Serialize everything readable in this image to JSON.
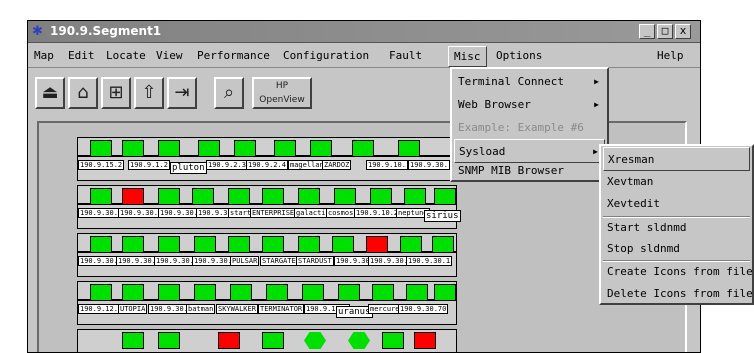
{
  "window": {
    "title": "190.9.Segment1",
    "minimize": "_",
    "maximize": "□",
    "close": "x"
  },
  "menubar": {
    "items": [
      "Map",
      "Edit",
      "Locate",
      "View",
      "Performance",
      "Configuration",
      "Fault",
      "Misc",
      "Options",
      "Help"
    ]
  },
  "toolbar": {
    "hp_label": "HP OpenView"
  },
  "misc_menu": {
    "items": [
      "Terminal Connect",
      "Web Browser",
      "Example: Example #6",
      "Sysload",
      "SNMP MIB Browser"
    ]
  },
  "sysload_menu": {
    "items": [
      "Xresman",
      "Xevtman",
      "Xevtedit",
      "Start sldnmd",
      "Stop sldnmd",
      "Create Icons from file",
      "Delete Icons from file"
    ]
  },
  "rows": [
    {
      "labels": [
        "190.9.15.2",
        "190.9.1.2",
        "pluton",
        "190.9.2.3",
        "190.9.2.4",
        "magellan",
        "ZARDOZ",
        "190.9.10.",
        "190.9.30."
      ]
    },
    {
      "labels": [
        "190.9.30.44",
        "190.9.30.24",
        "190.9.30.21",
        "190.9.30.6",
        "startrek",
        "ENTERPRISE",
        "galactica",
        "cosmos",
        "190.9.10.2",
        "neptune",
        "sirius",
        "saturne",
        "ti"
      ]
    },
    {
      "labels": [
        "190.9.30.",
        "190.9.30.6",
        "190.9.30.6",
        "190.9.30.69",
        "PULSAR",
        "STARGATE",
        "STARDUST",
        "190.9.30.",
        "190.9.30.1",
        "190.9.30.1",
        "190.9.30.3",
        "190.9.30.6",
        "190.9."
      ]
    },
    {
      "labels": [
        "190.9.12.13",
        "UTOPIA",
        "190.9.30.3",
        "batman",
        "SKYWALKER",
        "TERMINATOR",
        "190.9.10.1",
        "uranus",
        "mercure",
        "190.9.30.70",
        "190.9.30.27",
        "190.9.30.17",
        "190.9.30.69"
      ]
    }
  ]
}
